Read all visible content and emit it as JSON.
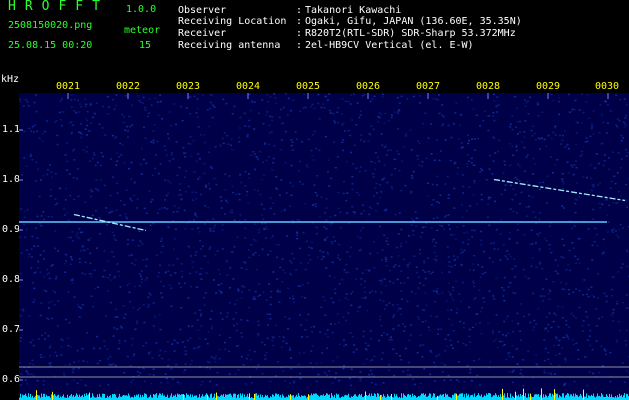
{
  "header": {
    "app_title": "HROFFT",
    "app_version": "1.0.0",
    "filename": "2508150020.png",
    "meteor_label": "meteor",
    "timestamp": "25.08.15 00:20",
    "meteor_count": "15"
  },
  "info": [
    {
      "key": "Observer",
      "value": "Takanori Kawachi"
    },
    {
      "key": "Receiving Location",
      "value": "Ogaki, Gifu, JAPAN (136.60E, 35.35N)"
    },
    {
      "key": "Receiver",
      "value": "R820T2(RTL-SDR) SDR-Sharp 53.372MHz"
    },
    {
      "key": "Receiving antenna",
      "value": "2el-HB9CV Vertical (el. E-W)"
    }
  ],
  "separator": ":",
  "axis": {
    "unit": "kHz",
    "time_labels": [
      "0021",
      "0022",
      "0023",
      "0024",
      "0025",
      "0026",
      "0027",
      "0028",
      "0029",
      "0030"
    ],
    "freq_labels": [
      "1.1",
      "1.0",
      "0.9",
      "0.8",
      "0.7",
      "0.6"
    ]
  },
  "chart_data": {
    "type": "heatmap",
    "xlabel": "",
    "ylabel": "kHz",
    "x_ticks": [
      "0021",
      "0022",
      "0023",
      "0024",
      "0025",
      "0026",
      "0027",
      "0028",
      "0029",
      "0030"
    ],
    "y_ticks": [
      1.1,
      1.0,
      0.9,
      0.8,
      0.7,
      0.6
    ],
    "ylim": [
      0.6,
      1.18
    ],
    "carrier_khz": 0.91,
    "horizontal_reference_khz": [
      0.62,
      0.6
    ],
    "meteor_echoes": [
      {
        "start": "0021.1",
        "end": "0022.3",
        "khz_start": 0.925,
        "khz_end": 0.893
      },
      {
        "start": "0028.1",
        "end": "0030.3",
        "khz_start": 0.995,
        "khz_end": 0.953
      }
    ],
    "colors": {
      "background": "#000048",
      "noise": "#1030a0",
      "signal": "#a0f0ff",
      "carrier": "#60c8ff",
      "spectrum": "#00d8ff",
      "peak": "#ffff00",
      "reference_line": "#c0c0c0"
    }
  }
}
